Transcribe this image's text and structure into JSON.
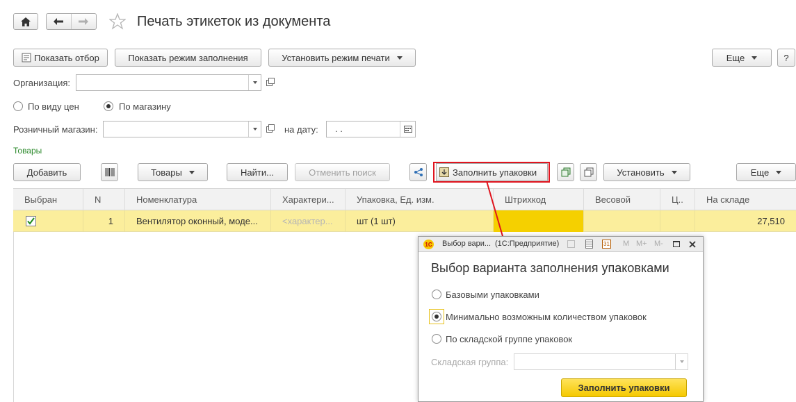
{
  "window": {
    "title": "Печать этикеток из документа"
  },
  "toolbar": {
    "show_filter": "Показать отбор",
    "show_fill_mode": "Показать режим заполнения",
    "set_print_mode": "Установить режим печати",
    "more": "Еще",
    "help": "?"
  },
  "form": {
    "organization_label": "Организация:",
    "organization_value": "",
    "radio_by_price": "По виду цен",
    "radio_by_store": "По магазину",
    "store_label": "Розничный магазин:",
    "store_value": "",
    "date_label": "на дату:",
    "date_value": " .  .",
    "section_title": "Товары"
  },
  "goods_toolbar": {
    "add": "Добавить",
    "goods": "Товары",
    "find": "Найти...",
    "cancel_search": "Отменить поиск",
    "fill_packages": "Заполнить упаковки",
    "set": "Установить",
    "more": "Еще"
  },
  "table": {
    "columns": [
      "Выбран",
      "N",
      "Номенклатура",
      "Характери...",
      "Упаковка, Ед. изм.",
      "Штрихкод",
      "Весовой",
      "Ц..",
      "На складе"
    ],
    "rows": [
      {
        "selected": true,
        "n": "1",
        "nomenclature": "Вентилятор оконный, моде...",
        "characteristic": "<характер...",
        "package": "шт (1 шт)",
        "barcode": "",
        "weight": "",
        "price": "",
        "stock": "27,510"
      }
    ]
  },
  "dialog": {
    "title_short": "Выбор вари...",
    "title_app": "(1С:Предприятие)",
    "heading": "Выбор варианта заполнения упаковками",
    "option_basic": "Базовыми упаковками",
    "option_min": "Минимально возможным количеством упаковок",
    "option_group": "По складской группе упаковок",
    "warehouse_group_label": "Складская группа:",
    "warehouse_group_value": "",
    "fill_button": "Заполнить упаковки",
    "selected_option": "option_min",
    "icon_m": "M",
    "icon_mplus": "M+",
    "icon_mminus": "M-"
  },
  "colors": {
    "row_highlight": "#fbee9c",
    "barcode_cell": "#f5d000",
    "annotation_red": "#e0141e",
    "section_green": "#2e8b2e",
    "dialog_button": "#f5c800"
  }
}
